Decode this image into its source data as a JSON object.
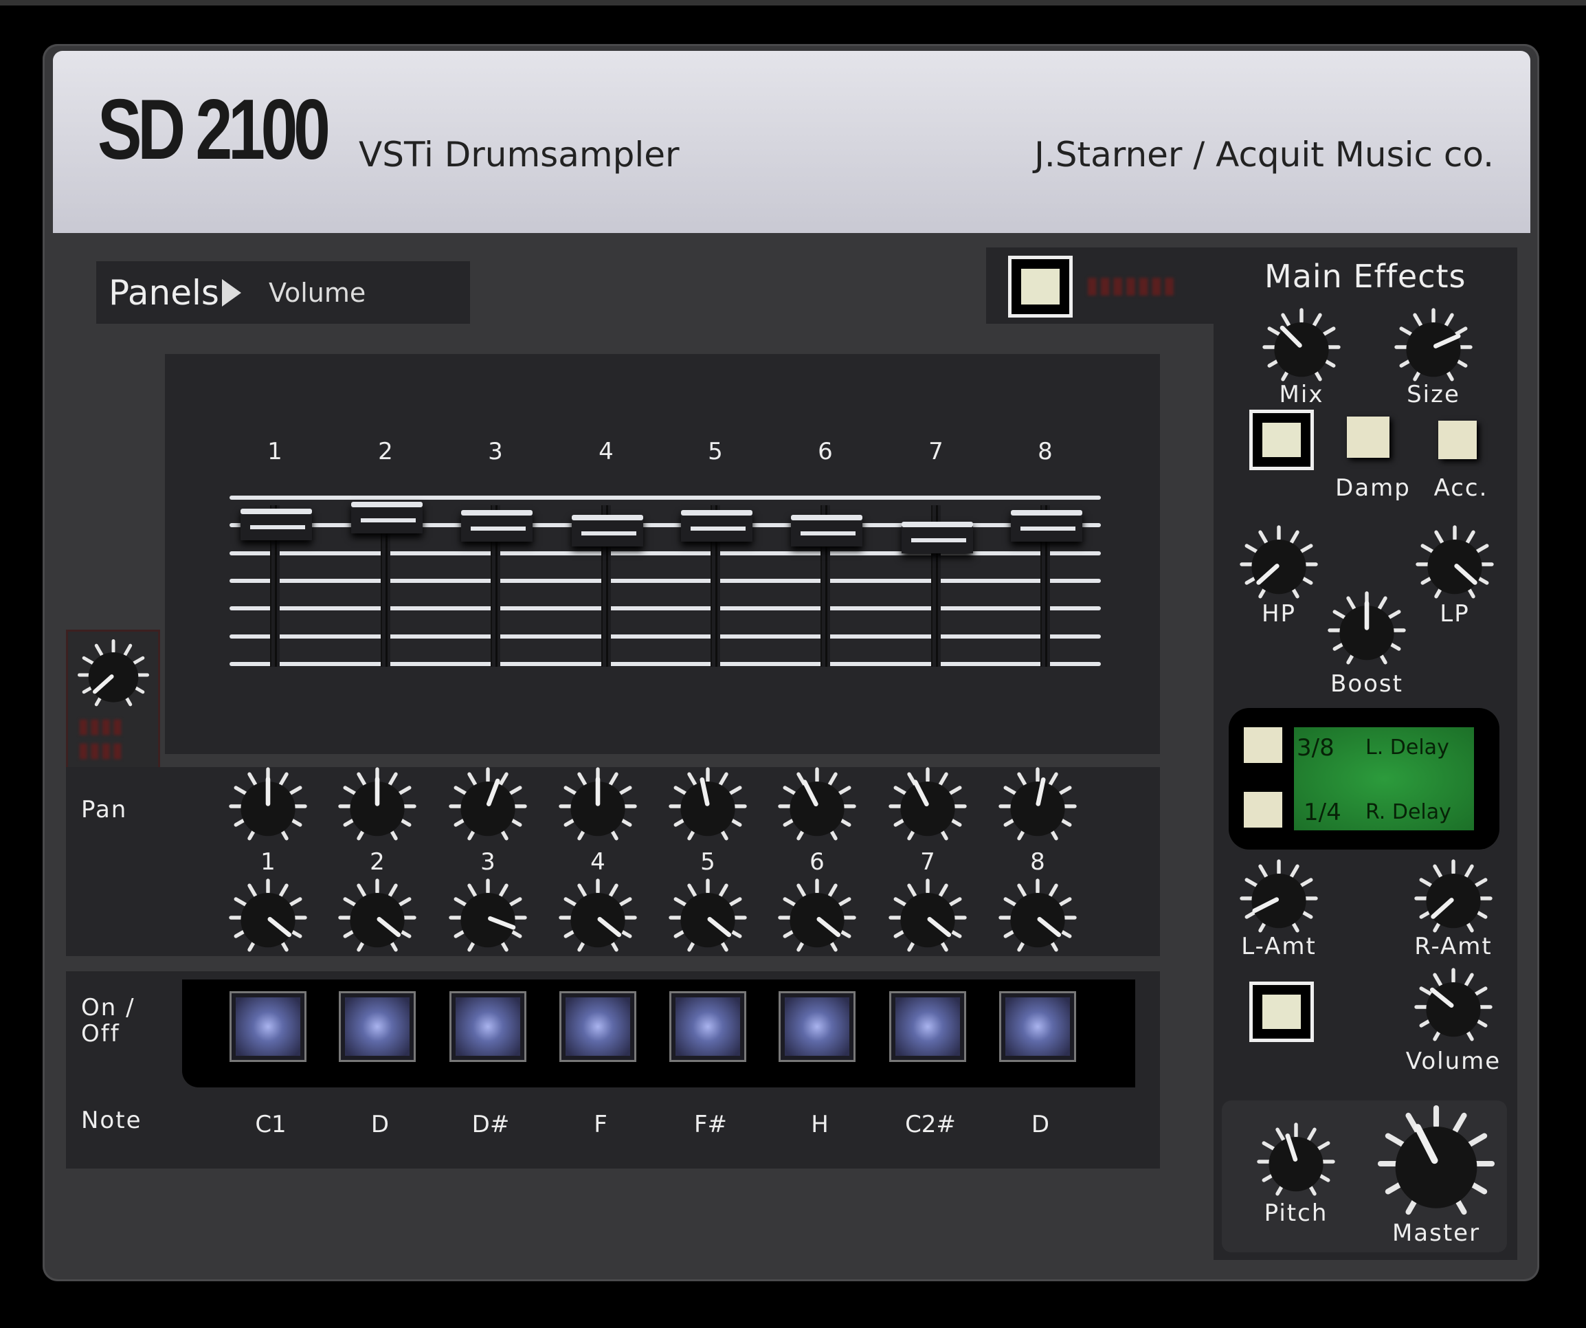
{
  "header": {
    "logo": "SD 2100",
    "subtitle": "VSTi Drumsampler",
    "maker": "J.Starner / Acquit Music co."
  },
  "panels": {
    "label": "Panels",
    "value": "Volume"
  },
  "channels": [
    "1",
    "2",
    "3",
    "4",
    "5",
    "6",
    "7",
    "8"
  ],
  "volume_faders": [
    0.89,
    0.93,
    0.88,
    0.85,
    0.88,
    0.85,
    0.81,
    0.88
  ],
  "main_volume_knob": 0.06,
  "pan": {
    "label": "Pan",
    "values": [
      0.5,
      0.5,
      0.57,
      0.5,
      0.46,
      0.41,
      0.41,
      0.54
    ]
  },
  "pitch": {
    "values": [
      0.93,
      0.93,
      0.87,
      0.93,
      0.93,
      0.93,
      0.93,
      0.93
    ]
  },
  "onoff": {
    "label_line1": "On /",
    "label_line2": "Off",
    "states": [
      true,
      true,
      true,
      true,
      true,
      true,
      true,
      true
    ]
  },
  "note": {
    "label": "Note",
    "values": [
      "C1",
      "D",
      "D#",
      "F",
      "F#",
      "H",
      "C2#",
      "D"
    ]
  },
  "effects": {
    "title": "Main Effects",
    "mix": {
      "label": "Mix",
      "value": 0.35
    },
    "size": {
      "label": "Size",
      "value": 0.72
    },
    "damp": {
      "label": "Damp"
    },
    "acc": {
      "label": "Acc."
    },
    "hp": {
      "label": "HP",
      "value": 0.06
    },
    "lp": {
      "label": "LP",
      "value": 0.94
    },
    "boost": {
      "label": "Boost",
      "value": 0.5
    },
    "delay": {
      "left_time": "3/8",
      "left_label": "L. Delay",
      "right_time": "1/4",
      "right_label": "R. Delay"
    },
    "l_amt": {
      "label": "L-Amt",
      "value": 0.11
    },
    "r_amt": {
      "label": "R-Amt",
      "value": 0.06
    },
    "volume": {
      "label": "Volume",
      "value": 0.33
    },
    "pitch": {
      "label": "Pitch",
      "value": 0.44
    },
    "master": {
      "label": "Master",
      "value": 0.41
    }
  },
  "colors": {
    "lcd": "#2c9b3c",
    "pad": "#5f6aa8",
    "button": "#e6e3c8",
    "header": "#d6d6de"
  }
}
